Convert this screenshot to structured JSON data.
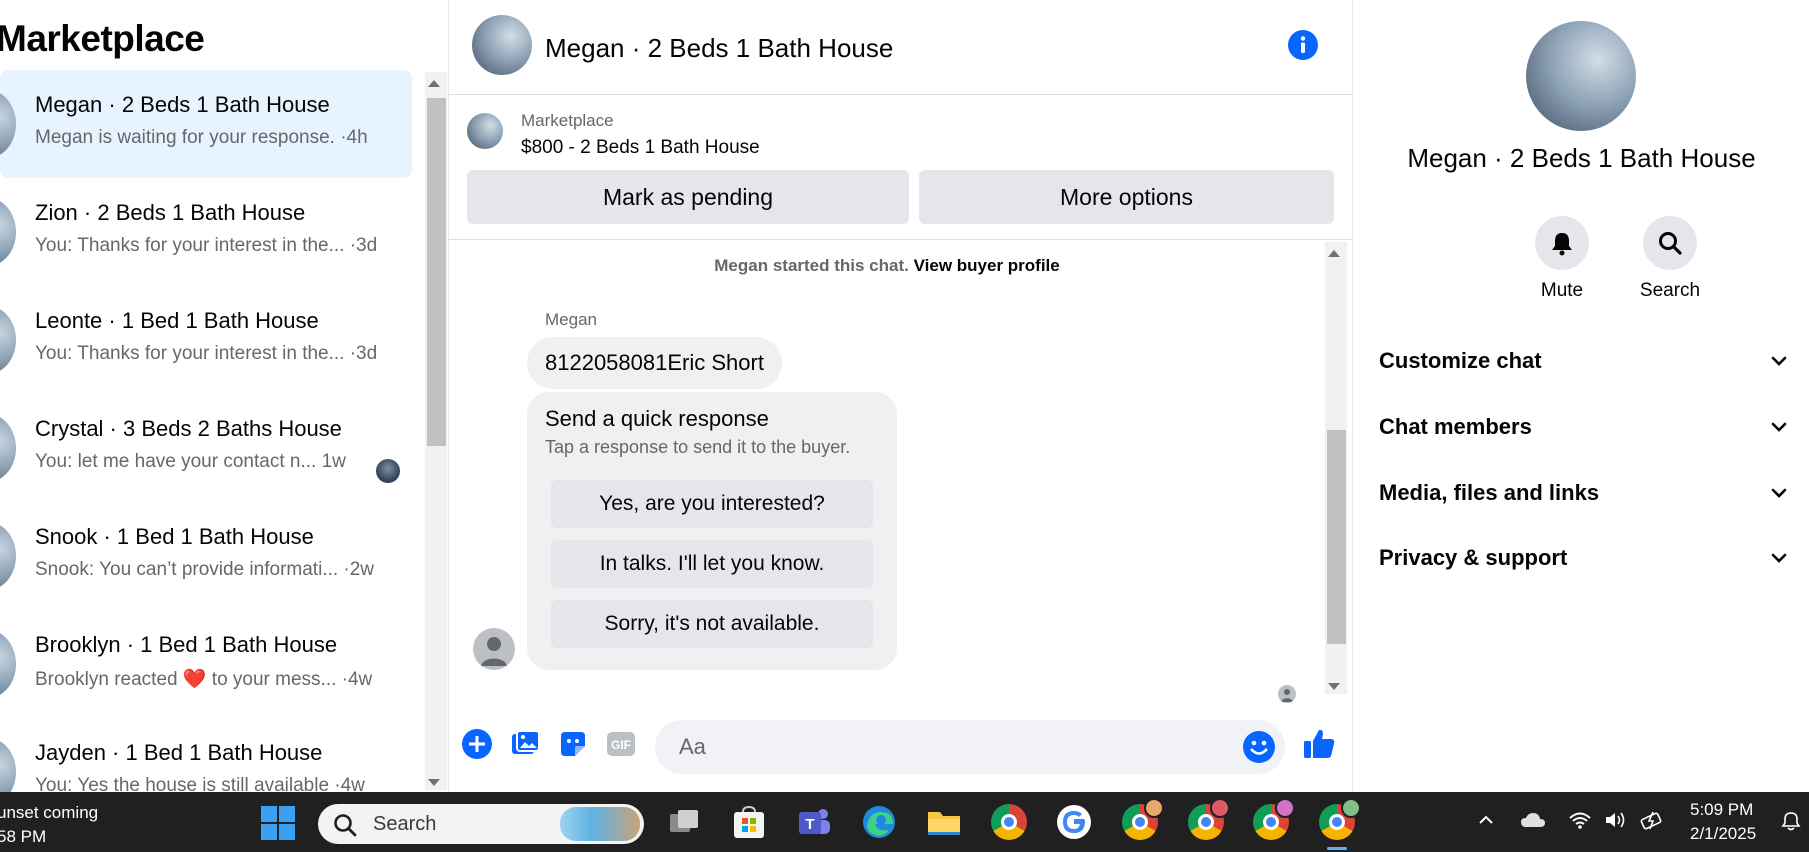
{
  "sidebar": {
    "title": "Marketplace",
    "conversations": [
      {
        "name": "Megan · 2 Beds 1 Bath House",
        "snippet": "Megan is waiting for your response. ·4h"
      },
      {
        "name": "Zion · 2 Beds 1 Bath House",
        "snippet": "You: Thanks for your interest in the... ·3d"
      },
      {
        "name": "Leonte · 1 Bed 1 Bath House",
        "snippet": "You: Thanks for your interest in the... ·3d"
      },
      {
        "name": "Crystal · 3 Beds 2 Baths House",
        "snippet": "You: let me have your contact n...  1w"
      },
      {
        "name": "Snook · 1 Bed 1 Bath House",
        "snippet": "Snook: You can’t provide informati... ·2w"
      },
      {
        "name": "Brooklyn · 1 Bed 1 Bath House",
        "snippet": "Brooklyn reacted ❤️ to your mess... ·4w"
      },
      {
        "name": "Jayden · 1 Bed 1 Bath House",
        "snippet": "You: Yes the house is still available ·4w"
      }
    ],
    "active_index": 0
  },
  "chat": {
    "header_title": "Megan · 2 Beds 1 Bath House",
    "listing": {
      "source": "Marketplace",
      "title": "$800 - 2 Beds 1 Bath House",
      "mark_pending_label": "Mark as pending",
      "more_options_label": "More options"
    },
    "system_text": "Megan started this chat.",
    "system_link": "View buyer profile",
    "sender_name": "Megan",
    "message_text": "8122058081Eric Short",
    "quick_response": {
      "title": "Send a quick response",
      "subtitle": "Tap a response to send it to the buyer.",
      "options": [
        "Yes, are you interested?",
        "In talks. I'll let you know.",
        "Sorry, it's not available."
      ]
    },
    "composer_placeholder": "Aa"
  },
  "details": {
    "name": "Megan · 2 Beds 1 Bath House",
    "actions": {
      "mute": "Mute",
      "search": "Search"
    },
    "sections": [
      "Customize chat",
      "Chat members",
      "Media, files and links",
      "Privacy & support"
    ]
  },
  "taskbar": {
    "weather_line1": "unset coming",
    "weather_line2": "58 PM",
    "search_placeholder": "Search",
    "time": "5:09 PM",
    "date": "2/1/2025"
  },
  "colors": {
    "accent": "#0866ff",
    "active_row": "#e7f3ff",
    "button_bg": "#e4e6eb",
    "taskbar_bg": "#202020"
  }
}
